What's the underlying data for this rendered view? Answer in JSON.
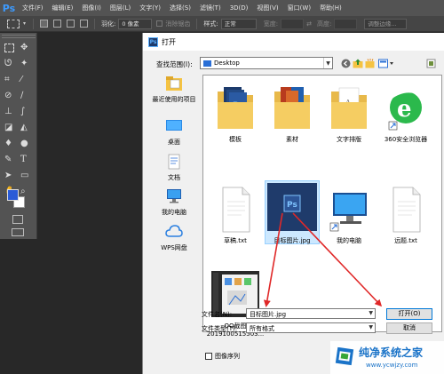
{
  "app": {
    "logo": "Ps",
    "menu": [
      "文件(F)",
      "编辑(E)",
      "图像(I)",
      "图层(L)",
      "文字(Y)",
      "选择(S)",
      "滤镜(T)",
      "3D(D)",
      "视图(V)",
      "窗口(W)",
      "帮助(H)"
    ]
  },
  "options_bar": {
    "feather_label": "羽化:",
    "feather_value": "0 像素",
    "antialias_label": "消除锯齿",
    "style_label": "样式:",
    "style_value": "正常",
    "width_label": "宽度:",
    "height_label": "高度:",
    "refine_label": "调整边缘..."
  },
  "dialog": {
    "title": "打开",
    "lookin_label": "查找范围(I):",
    "lookin_value": "Desktop",
    "places": [
      {
        "label": "最近使用的项目",
        "icon": "recent-icon"
      },
      {
        "label": "桌面",
        "icon": "desktop-icon"
      },
      {
        "label": "文档",
        "icon": "documents-icon"
      },
      {
        "label": "我的电脑",
        "icon": "computer-icon"
      },
      {
        "label": "WPS网盘",
        "icon": "cloud-icon"
      }
    ],
    "files": [
      {
        "label": "模板",
        "icon": "folder-icon"
      },
      {
        "label": "素材",
        "icon": "folder-icon"
      },
      {
        "label": "文字排版",
        "icon": "folder-icon"
      },
      {
        "label": "360安全浏览器",
        "icon": "browser-icon"
      },
      {
        "label": "草稿.txt",
        "icon": "text-file-icon"
      },
      {
        "label": "目标图片.jpg",
        "icon": "psd-image-icon"
      },
      {
        "label": "我的电脑",
        "icon": "computer-icon"
      },
      {
        "label": "远题.txt",
        "icon": "text-file-icon"
      },
      {
        "label": "QQ截图",
        "label2": "2019100515503...",
        "icon": "screenshot-icon"
      }
    ],
    "filename_label": "文件名(N):",
    "filename_value": "目标图片.jpg",
    "filetype_label": "文件类型(T):",
    "filetype_value": "所有格式",
    "open_button": "打开(O)",
    "cancel_button": "取消",
    "image_sequence_label": "图像序列"
  },
  "watermark": {
    "title": "纯净系统之家",
    "url": "www.ycwjzy.com"
  }
}
